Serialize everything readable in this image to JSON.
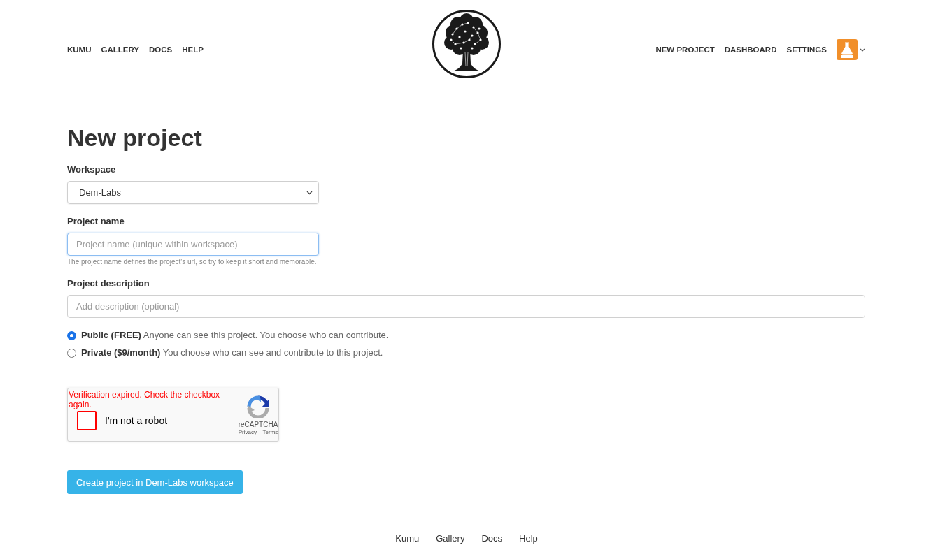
{
  "header": {
    "left_nav": [
      "KUMU",
      "GALLERY",
      "DOCS",
      "HELP"
    ],
    "right_nav": [
      "NEW PROJECT",
      "DASHBOARD",
      "SETTINGS"
    ]
  },
  "form": {
    "title": "New project",
    "workspace": {
      "label": "Workspace",
      "value": "Dem-Labs"
    },
    "project_name": {
      "label": "Project name",
      "placeholder": "Project name (unique within workspace)",
      "focused": true,
      "hint": "The project name defines the project's url, so try to keep it short and memorable."
    },
    "description": {
      "label": "Project description",
      "placeholder": "Add description (optional)"
    },
    "visibility": [
      {
        "text": "**Public (FREE)** Anyone can see this project. You choose who can contribute.",
        "selected": true
      },
      {
        "text": "**Private ($9/month)** You choose who can see and contribute to this project.",
        "selected": false
      }
    ],
    "captcha": {
      "error": "Verification expired. Check the checkbox again.",
      "checked": false,
      "label": "I'm not a robot",
      "brand": "reCAPTCHA",
      "links": [
        "Privacy",
        "Terms"
      ],
      "separator": "-"
    },
    "submit": "Create project in Dem-Labs workspace"
  },
  "footer": {
    "links": [
      "Kumu",
      "Gallery",
      "Docs",
      "Help"
    ]
  }
}
